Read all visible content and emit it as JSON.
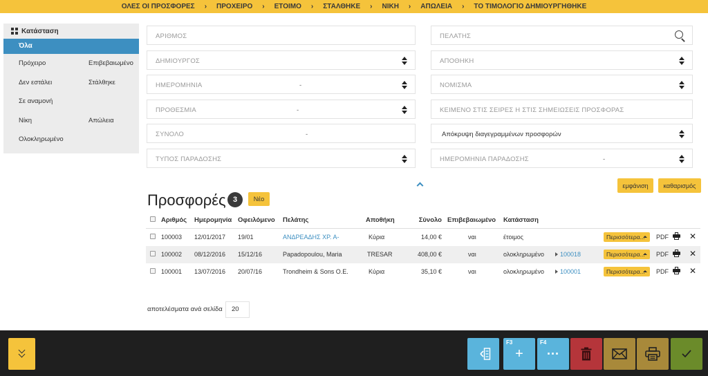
{
  "steps": [
    "ΟΛΕΣ ΟΙ ΠΡΟΣΦΟΡΕΣ",
    "ΠΡΟΧΕΙΡΟ",
    "ΕΤΟΙΜΟ",
    "ΣΤΑΛΘΗΚΕ",
    "ΝΙΚΗ",
    "ΑΠΩΛΕΙΑ",
    "ΤΟ ΤΙΜΟΛΟΓΙΟ ΔΗΜΙΟΥΡΓΗΘΗΚΕ"
  ],
  "sidebar": {
    "title": "Κατάσταση",
    "active": "Όλα",
    "items": [
      [
        "Πρόχειρο",
        "Επιβεβαιωμένο"
      ],
      [
        "Δεν εστάλει",
        "Στάλθηκε"
      ],
      [
        "Σε αναμονή",
        ""
      ],
      [
        "Νίκη",
        "Απώλεια"
      ],
      [
        "Ολοκληρωμένο",
        ""
      ]
    ]
  },
  "filters": {
    "number": "ΑΡΙΘΜΟΣ",
    "creator": "ΔΗΜΙΟΥΡΓΟΣ",
    "date": "ΗΜΕΡΟΜΗΝΙΑ",
    "date_sep": "-",
    "deadline": "ΠΡΟΘΕΣΜΙΑ",
    "deadline_sep": "-",
    "total": "ΣΥΝΟΛΟ",
    "total_sep": "-",
    "delivery_type": "ΤΥΠΟΣ ΠΑΡΑΔΟΣΗΣ",
    "customer": "ΠΕΛΑΤΗΣ",
    "warehouse": "ΑΠΟΘΗΚΗ",
    "currency": "ΝΟΜΙΣΜΑ",
    "notes_text": "ΚΕΙΜΕΝΟ ΣΤΙΣ ΣΕΙΡΕΣ Η ΣΤΙΣ ΣΗΜΕΙΩΣΕΙΣ ΠΡΟΣΦΟΡΑΣ",
    "hide_deleted": "Απόκρυψη διαγεγραμμένων προσφορών",
    "delivery_date": "ΗΜΕΡΟΜΗΝΙΑ ΠΑΡΑΔΟΣΗΣ",
    "delivery_date_sep": "-",
    "show_label": "εμφάνιση",
    "clear_label": "καθαρισμός"
  },
  "list": {
    "title": "Προσφορές",
    "count": "3",
    "new_label": "Νέο",
    "columns": [
      "Αριθμός",
      "Ημερομηνία",
      "Οφειλόμενο",
      "Πελάτης",
      "Αποθήκη",
      "Σύνολο",
      "Επιβεβαιωμένο",
      "Κατάσταση"
    ],
    "rows": [
      {
        "number": "100003",
        "date": "12/01/2017",
        "due": "19/01",
        "customer": "ΑΝΔΡΕΑΔΗΣ ΧΡ. Α-",
        "warehouse": "Κύρια",
        "total": "14,00 €",
        "confirmed": "ναι",
        "status": "έτοιμος",
        "ref": ""
      },
      {
        "number": "100002",
        "date": "08/12/2016",
        "due": "15/12/16",
        "customer": "Papadopoulou, Maria",
        "warehouse": "TRESAR",
        "total": "408,00 €",
        "confirmed": "ναι",
        "status": "ολοκληρωμένο",
        "ref": "100018"
      },
      {
        "number": "100001",
        "date": "13/07/2016",
        "due": "20/07/16",
        "customer": "Trondheim & Sons Ο.Ε.",
        "warehouse": "Κύρια",
        "total": "35,10 €",
        "confirmed": "ναι",
        "status": "ολοκληρωμένο",
        "ref": "100001"
      }
    ],
    "more_label": "Περισσότερα...",
    "pdf_label": "PDF",
    "per_page_label": "αποτελέσματα ανά σελίδα",
    "per_page_value": "20"
  },
  "actions": [
    {
      "name": "split-view",
      "fkey": "",
      "color": "#5ab4dc"
    },
    {
      "name": "add",
      "fkey": "F3",
      "color": "#5ab4dc"
    },
    {
      "name": "more",
      "fkey": "F4",
      "color": "#5ab4dc"
    },
    {
      "name": "delete",
      "fkey": "",
      "color": "#b5353a"
    },
    {
      "name": "email",
      "fkey": "",
      "color": "#a8893a"
    },
    {
      "name": "print",
      "fkey": "",
      "color": "#a8893a"
    },
    {
      "name": "confirm",
      "fkey": "",
      "color": "#6b8b2a"
    }
  ]
}
